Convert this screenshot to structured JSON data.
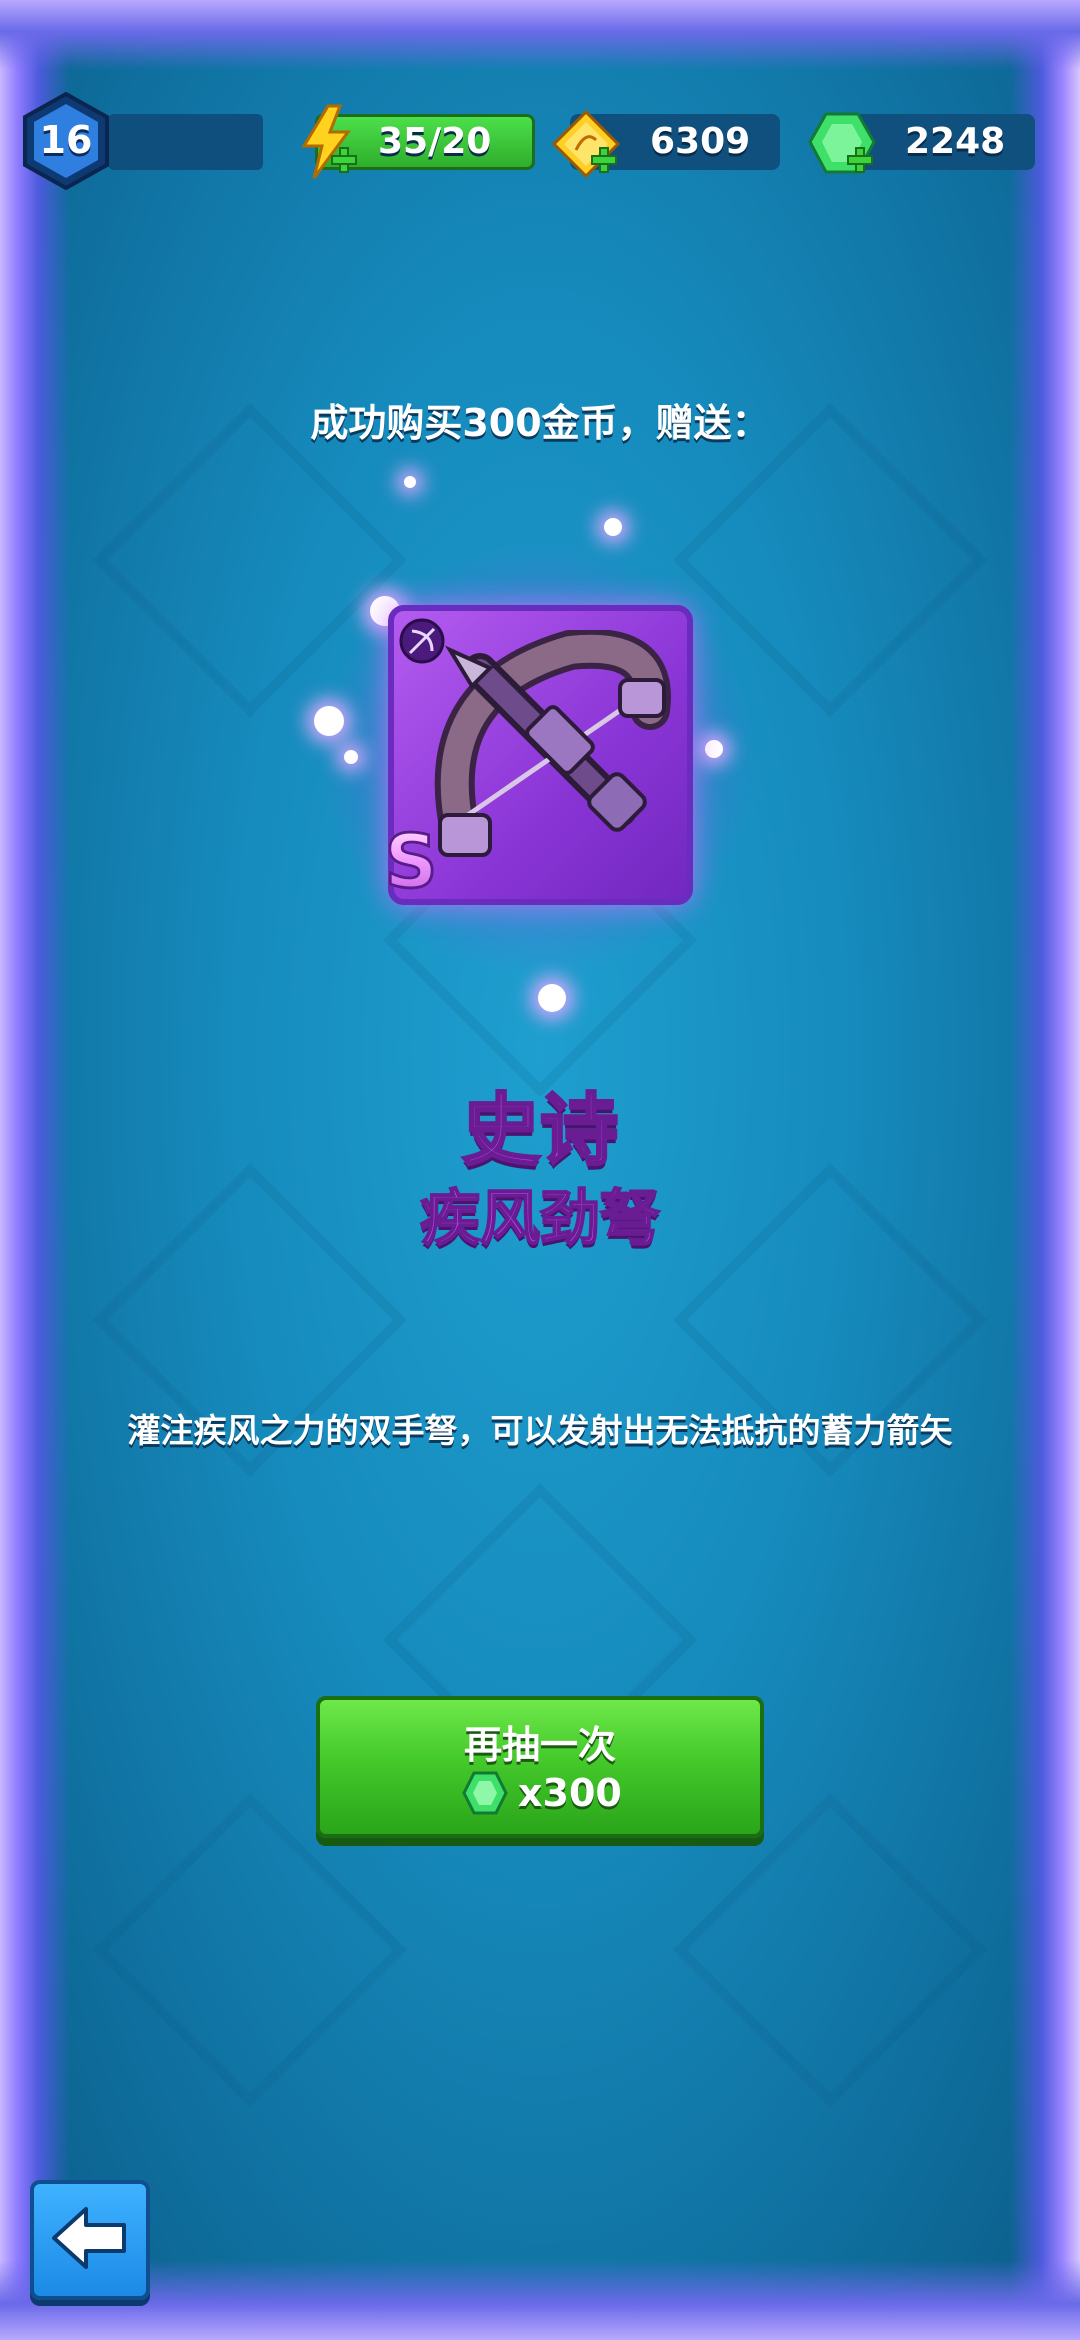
{
  "header": {
    "level": "16",
    "energy": "35/20",
    "gold": "6309",
    "gems": "2248"
  },
  "reward": {
    "message": "成功购买300金币，赠送：",
    "grade": "S",
    "rarity": "史诗",
    "name": "疾风劲弩",
    "description": "灌注疾风之力的双手弩，可以发射出无法抵抗的蓄力箭矢"
  },
  "retry_button": {
    "label": "再抽一次",
    "cost": "x300"
  },
  "icons": {
    "level": "hexagon-badge-icon",
    "energy": "lightning-icon",
    "gold": "gold-ticket-icon",
    "gems": "green-gem-icon",
    "weapon_type": "bow-type-icon",
    "back": "back-arrow-icon"
  },
  "colors": {
    "rarity_epic": "#c24cf2",
    "button_green": "#44c92b",
    "background": "#168bbd"
  }
}
